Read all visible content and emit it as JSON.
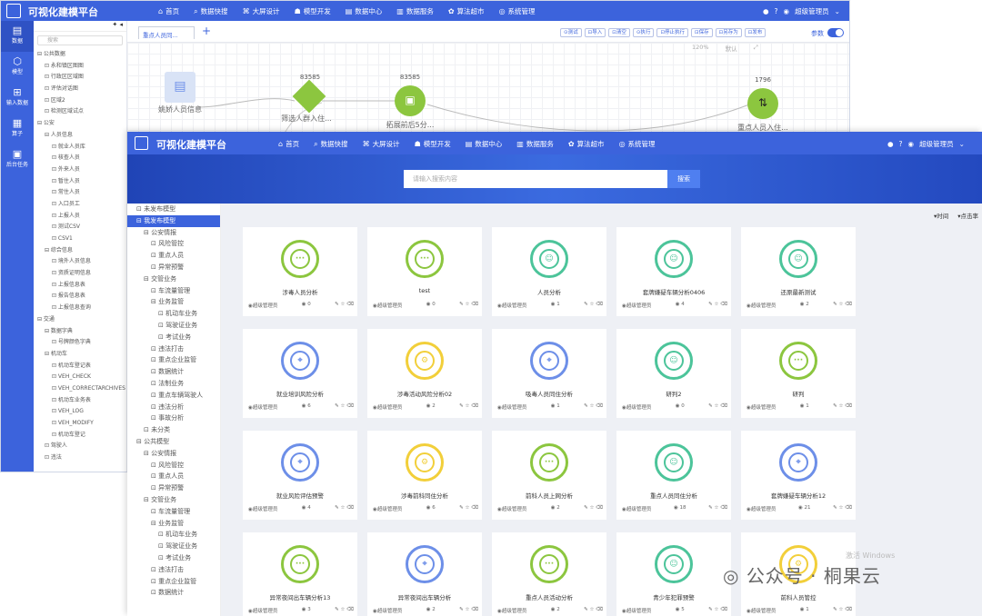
{
  "app_title": "可视化建模平台",
  "nav": [
    {
      "icon": "home-icon",
      "glyph": "⌂",
      "label": "首页"
    },
    {
      "icon": "search-icon",
      "glyph": "⌕",
      "label": "数据快搜"
    },
    {
      "icon": "design-icon",
      "glyph": "⌘",
      "label": "大屏设计"
    },
    {
      "icon": "model-dev-icon",
      "glyph": "☗",
      "label": "模型开发"
    },
    {
      "icon": "data-center-icon",
      "glyph": "▤",
      "label": "数据中心"
    },
    {
      "icon": "data-service-icon",
      "glyph": "▥",
      "label": "数据服务"
    },
    {
      "icon": "algorithm-market-icon",
      "glyph": "✿",
      "label": "算法超市"
    },
    {
      "icon": "system-manage-icon",
      "glyph": "◎",
      "label": "系统管理"
    }
  ],
  "user_back": "超级管理员",
  "user_front": "超级管理员",
  "back": {
    "rail": [
      {
        "icon": "data-icon",
        "glyph": "▤",
        "label": "数据"
      },
      {
        "icon": "model-icon",
        "glyph": "⬡",
        "label": "模型"
      },
      {
        "icon": "input-data-icon",
        "glyph": "⊞",
        "label": "输入数据"
      },
      {
        "icon": "operator-icon",
        "glyph": "▦",
        "label": "算子"
      },
      {
        "icon": "output-icon",
        "glyph": "▣",
        "label": "后台任务"
      }
    ],
    "search_placeholder": "搜索",
    "tree": [
      "⊟ 公共数据",
      "⊡ 永和镇区图图",
      "⊡ 行政区区域图",
      "⊡ 评估对话图",
      "⊡ 区域2",
      "⊡ 检测区域试点",
      "⊟ 公安",
      "⊟ 人员信息",
      "⊡ 就业人员库",
      "⊡ 核查人员",
      "⊡ 外来人员",
      "⊡ 暂住人员",
      "⊡ 常住人员",
      "⊡ 入口员工",
      "⊡ 上报人员",
      "⊡ 测试CSV",
      "⊡ CSV1",
      "⊟ 综合信息",
      "⊡ 境外人员信息",
      "⊡ 资质证明信息",
      "⊡ 上报信息表",
      "⊡ 报告信息表",
      "⊡ 上报信息查询",
      "⊟ 交通",
      "⊟ 数据字典",
      "⊡ 号牌颜色字典",
      "⊟ 机动车",
      "⊡ 机动车登记表",
      "⊡ VEH_CHECK",
      "⊡ VEH_CORRECTARCHIVES",
      "⊡ 机动车业务表",
      "⊡ VEH_LOG",
      "⊡ VEH_MODIFY",
      "⊡ 机动车登记",
      "⊡ 驾驶人",
      "⊡ 违法"
    ],
    "editor_tab": "重点人员同...",
    "tools": [
      "⊙测试",
      "⊡导入",
      "⊡清空",
      "⊙执行",
      "⊡停止执行",
      "⊡保存",
      "⊡另存为",
      "⊡发布"
    ],
    "param_label": "参数",
    "zoom": [
      "120%",
      "默认"
    ],
    "nodes": [
      {
        "count": "",
        "label": "姚娇人员信息"
      },
      {
        "count": "83585",
        "label": "筛选人群入住..."
      },
      {
        "count": "83585",
        "label": "拓展前后5分..."
      },
      {
        "count": "1796",
        "label": "重点人员入住..."
      }
    ]
  },
  "front": {
    "search_placeholder": "请输入搜索内容",
    "search_button": "搜索",
    "tree": [
      {
        "t": "⊡ 未发布模型",
        "sel": false,
        "in": 0
      },
      {
        "t": "⊟ 我发布模型",
        "sel": true,
        "in": 0
      },
      {
        "t": "⊟ 公安情报",
        "sel": false,
        "in": 1
      },
      {
        "t": "⊡ 风险管控",
        "sel": false,
        "in": 2
      },
      {
        "t": "⊡ 重点人员",
        "sel": false,
        "in": 2
      },
      {
        "t": "⊡ 异常预警",
        "sel": false,
        "in": 2
      },
      {
        "t": "⊟ 交管业务",
        "sel": false,
        "in": 1
      },
      {
        "t": "⊡ 车流量管理",
        "sel": false,
        "in": 2
      },
      {
        "t": "⊟ 业务监管",
        "sel": false,
        "in": 2
      },
      {
        "t": "⊡ 机动车业务",
        "sel": false,
        "in": 3
      },
      {
        "t": "⊡ 驾驶证业务",
        "sel": false,
        "in": 3
      },
      {
        "t": "⊡ 考试业务",
        "sel": false,
        "in": 3
      },
      {
        "t": "⊡ 违法打击",
        "sel": false,
        "in": 2
      },
      {
        "t": "⊡ 重点企业监管",
        "sel": false,
        "in": 2
      },
      {
        "t": "⊡ 数据统计",
        "sel": false,
        "in": 2
      },
      {
        "t": "⊡ 法制业务",
        "sel": false,
        "in": 2
      },
      {
        "t": "⊡ 重点车辆驾驶人",
        "sel": false,
        "in": 2
      },
      {
        "t": "⊡ 违法分析",
        "sel": false,
        "in": 2
      },
      {
        "t": "⊡ 事故分析",
        "sel": false,
        "in": 2
      },
      {
        "t": "⊡ 未分类",
        "sel": false,
        "in": 1
      },
      {
        "t": "⊟ 公共模型",
        "sel": false,
        "in": 0
      },
      {
        "t": "⊟ 公安情报",
        "sel": false,
        "in": 1
      },
      {
        "t": "⊡ 风险管控",
        "sel": false,
        "in": 2
      },
      {
        "t": "⊡ 重点人员",
        "sel": false,
        "in": 2
      },
      {
        "t": "⊡ 异常预警",
        "sel": false,
        "in": 2
      },
      {
        "t": "⊟ 交管业务",
        "sel": false,
        "in": 1
      },
      {
        "t": "⊡ 车流量管理",
        "sel": false,
        "in": 2
      },
      {
        "t": "⊟ 业务监管",
        "sel": false,
        "in": 2
      },
      {
        "t": "⊡ 机动车业务",
        "sel": false,
        "in": 3
      },
      {
        "t": "⊡ 驾驶证业务",
        "sel": false,
        "in": 3
      },
      {
        "t": "⊡ 考试业务",
        "sel": false,
        "in": 3
      },
      {
        "t": "⊡ 违法打击",
        "sel": false,
        "in": 2
      },
      {
        "t": "⊡ 重点企业监管",
        "sel": false,
        "in": 2
      },
      {
        "t": "⊡ 数据统计",
        "sel": false,
        "in": 2
      }
    ],
    "sort": [
      "▾时间",
      "▾点击率"
    ],
    "cards": [
      {
        "title": "涉毒人员分析",
        "icon": "chat-icon",
        "glyph": "···",
        "color": "green",
        "owner": "超级管理员",
        "views": "0"
      },
      {
        "title": "test",
        "icon": "chat-icon",
        "glyph": "···",
        "color": "green",
        "owner": "超级管理员",
        "views": "0"
      },
      {
        "title": "人员分析",
        "icon": "face-scan-icon",
        "glyph": "☺",
        "color": "teal",
        "owner": "超级管理员",
        "views": "1"
      },
      {
        "title": "套牌嫌疑车辆分析0406",
        "icon": "face-scan-icon",
        "glyph": "☺",
        "color": "teal",
        "owner": "超级管理员",
        "views": "4"
      },
      {
        "title": "还原最新测试",
        "icon": "face-scan-icon",
        "glyph": "☺",
        "color": "teal",
        "owner": "超级管理员",
        "views": "2"
      },
      {
        "title": "就业培训风险分析",
        "icon": "location-icon",
        "glyph": "⌖",
        "color": "blue",
        "owner": "超级管理员",
        "views": "6"
      },
      {
        "title": "涉毒活动风险分析02",
        "icon": "gear-icon",
        "glyph": "⚙",
        "color": "yellow",
        "owner": "超级管理员",
        "views": "2"
      },
      {
        "title": "吸毒人员同住分析",
        "icon": "location-icon",
        "glyph": "⌖",
        "color": "blue",
        "owner": "超级管理员",
        "views": "1"
      },
      {
        "title": "研判2",
        "icon": "face-scan-icon",
        "glyph": "☺",
        "color": "teal",
        "owner": "超级管理员",
        "views": "0"
      },
      {
        "title": "研判",
        "icon": "chat-icon",
        "glyph": "···",
        "color": "green",
        "owner": "超级管理员",
        "views": "1"
      },
      {
        "title": "就业风险评估预警",
        "icon": "location-icon",
        "glyph": "⌖",
        "color": "blue",
        "owner": "超级管理员",
        "views": "4"
      },
      {
        "title": "涉毒前科同住分析",
        "icon": "gear-icon",
        "glyph": "⚙",
        "color": "yellow",
        "owner": "超级管理员",
        "views": "6"
      },
      {
        "title": "前科人员上网分析",
        "icon": "chat-icon",
        "glyph": "···",
        "color": "green",
        "owner": "超级管理员",
        "views": "2"
      },
      {
        "title": "重点人员同住分析",
        "icon": "face-scan-icon",
        "glyph": "☺",
        "color": "teal",
        "owner": "超级管理员",
        "views": "18"
      },
      {
        "title": "套牌嫌疑车辆分析12",
        "icon": "location-icon",
        "glyph": "⌖",
        "color": "blue",
        "owner": "超级管理员",
        "views": "21"
      },
      {
        "title": "异常夜间出车辆分析13",
        "icon": "chat-icon",
        "glyph": "···",
        "color": "green",
        "owner": "超级管理员",
        "views": "3"
      },
      {
        "title": "异常夜间出车辆分析",
        "icon": "location-icon",
        "glyph": "⌖",
        "color": "blue",
        "owner": "超级管理员",
        "views": "2"
      },
      {
        "title": "重点人员活动分析",
        "icon": "chat-icon",
        "glyph": "···",
        "color": "green",
        "owner": "超级管理员",
        "views": "2"
      },
      {
        "title": "青少年犯罪预警",
        "icon": "face-scan-icon",
        "glyph": "☺",
        "color": "teal",
        "owner": "超级管理员",
        "views": "5"
      },
      {
        "title": "前科人员管控",
        "icon": "gear-icon",
        "glyph": "⚙",
        "color": "yellow",
        "owner": "超级管理员",
        "views": "1"
      }
    ]
  },
  "watermark": "公众号 · 桐果云",
  "windows_hint": "激活 Windows"
}
